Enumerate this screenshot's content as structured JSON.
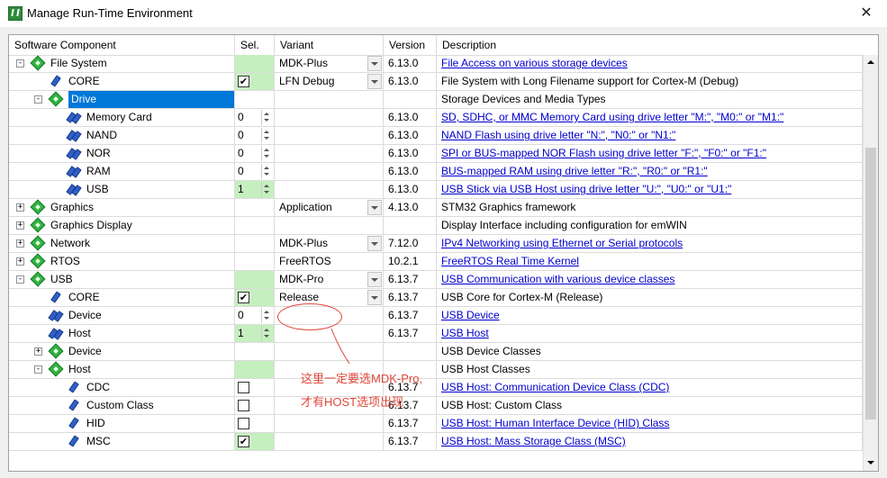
{
  "window": {
    "title": "Manage Run-Time Environment",
    "close": "✕"
  },
  "columns": [
    "Software Component",
    "Sel.",
    "Variant",
    "Version",
    "Description"
  ],
  "rows": [
    {
      "name": "File System",
      "level": 1,
      "exp": "-",
      "icon": "gem",
      "sel": "green",
      "variant": "MDK-Plus",
      "dropdown": true,
      "version": "6.13.0",
      "desc": "File Access on various storage devices",
      "link": true
    },
    {
      "name": "CORE",
      "level": 2,
      "exp": "",
      "icon": "pin",
      "sel": "check-on",
      "variant": "LFN Debug",
      "dropdown": true,
      "version": "6.13.0",
      "desc": "File System with Long Filename support for Cortex-M (Debug)",
      "link": false
    },
    {
      "name": "Drive",
      "level": 2,
      "exp": "-",
      "icon": "gem",
      "selected": true,
      "sel": "none",
      "variant": "",
      "version": "",
      "desc": "Storage Devices and Media Types",
      "link": false
    },
    {
      "name": "Memory Card",
      "level": 3,
      "exp": "",
      "icon": "pair",
      "sel": "spin",
      "spin": "0",
      "variant": "",
      "version": "6.13.0",
      "desc": "SD, SDHC, or MMC Memory Card using drive letter \"M:\", \"M0:\" or \"M1:\"",
      "link": true
    },
    {
      "name": "NAND",
      "level": 3,
      "exp": "",
      "icon": "pair",
      "sel": "spin",
      "spin": "0",
      "variant": "",
      "version": "6.13.0",
      "desc": "NAND Flash using drive letter \"N:\", \"N0:\" or \"N1:\"",
      "link": true
    },
    {
      "name": "NOR",
      "level": 3,
      "exp": "",
      "icon": "pair",
      "sel": "spin",
      "spin": "0",
      "variant": "",
      "version": "6.13.0",
      "desc": "SPI or BUS-mapped NOR Flash using drive letter \"F:\", \"F0:\" or \"F1:\"",
      "link": true
    },
    {
      "name": "RAM",
      "level": 3,
      "exp": "",
      "icon": "pair",
      "sel": "spin",
      "spin": "0",
      "variant": "",
      "version": "6.13.0",
      "desc": "BUS-mapped RAM using drive letter \"R:\", \"R0:\" or \"R1:\"",
      "link": true
    },
    {
      "name": "USB",
      "level": 3,
      "exp": "",
      "icon": "pair",
      "sel": "spin-green",
      "spin": "1",
      "variant": "",
      "version": "6.13.0",
      "desc": "USB Stick via USB Host using drive letter \"U:\", \"U0:\" or \"U1:\"",
      "link": true
    },
    {
      "name": "Graphics",
      "level": 1,
      "exp": "+",
      "icon": "gem",
      "sel": "none",
      "variant": "Application",
      "dropdown": true,
      "version": "4.13.0",
      "desc": "STM32 Graphics framework",
      "link": false
    },
    {
      "name": "Graphics Display",
      "level": 1,
      "exp": "+",
      "icon": "gem",
      "sel": "none",
      "variant": "",
      "version": "",
      "desc": "Display Interface including configuration for emWIN",
      "link": false
    },
    {
      "name": "Network",
      "level": 1,
      "exp": "+",
      "icon": "gem",
      "sel": "none",
      "variant": "MDK-Plus",
      "dropdown": true,
      "version": "7.12.0",
      "desc": "IPv4 Networking using Ethernet or Serial protocols",
      "link": true
    },
    {
      "name": "RTOS",
      "level": 1,
      "exp": "+",
      "icon": "gem",
      "sel": "none",
      "variant": "FreeRTOS",
      "dropdown": false,
      "version": "10.2.1",
      "desc": "FreeRTOS Real Time Kernel",
      "link": true
    },
    {
      "name": "USB",
      "level": 1,
      "exp": "-",
      "icon": "gem",
      "sel": "green",
      "variant": "MDK-Pro",
      "dropdown": true,
      "version": "6.13.7",
      "desc": "USB Communication with various device classes",
      "link": true
    },
    {
      "name": "CORE",
      "level": 2,
      "exp": "",
      "icon": "pin",
      "sel": "check-on",
      "variant": "Release",
      "dropdown": true,
      "version": "6.13.7",
      "desc": "USB Core for Cortex-M (Release)",
      "link": false
    },
    {
      "name": "Device",
      "level": 2,
      "exp": "",
      "icon": "pair",
      "sel": "spin",
      "spin": "0",
      "variant": "",
      "version": "6.13.7",
      "desc": "USB Device",
      "link": true
    },
    {
      "name": "Host",
      "level": 2,
      "exp": "",
      "icon": "pair",
      "sel": "spin-green",
      "spin": "1",
      "variant": "",
      "version": "6.13.7",
      "desc": "USB Host",
      "link": true
    },
    {
      "name": "Device",
      "level": 2,
      "exp": "+",
      "icon": "gem",
      "sel": "none",
      "variant": "",
      "version": "",
      "desc": "USB Device Classes",
      "link": false
    },
    {
      "name": "Host",
      "level": 2,
      "exp": "-",
      "icon": "gem",
      "sel": "green",
      "variant": "",
      "version": "",
      "desc": "USB Host Classes",
      "link": false
    },
    {
      "name": "CDC",
      "level": 3,
      "exp": "",
      "icon": "pin",
      "sel": "check-off",
      "variant": "",
      "version": "6.13.7",
      "desc": "USB Host: Communication Device Class (CDC)",
      "link": true
    },
    {
      "name": "Custom Class",
      "level": 3,
      "exp": "",
      "icon": "pin",
      "sel": "check-off",
      "variant": "",
      "version": "6.13.7",
      "desc": "USB Host: Custom Class",
      "link": false
    },
    {
      "name": "HID",
      "level": 3,
      "exp": "",
      "icon": "pin",
      "sel": "check-off",
      "variant": "",
      "version": "6.13.7",
      "desc": "USB Host: Human Interface Device (HID) Class",
      "link": true
    },
    {
      "name": "MSC",
      "level": 3,
      "exp": "",
      "icon": "pin",
      "sel": "check-on",
      "variant": "",
      "version": "6.13.7",
      "desc": "USB Host: Mass Storage Class (MSC)",
      "link": true
    }
  ],
  "annotation": {
    "text": "这里一定要选MDK-Pro,才有HOST选项出现",
    "color": "#e0473a"
  }
}
